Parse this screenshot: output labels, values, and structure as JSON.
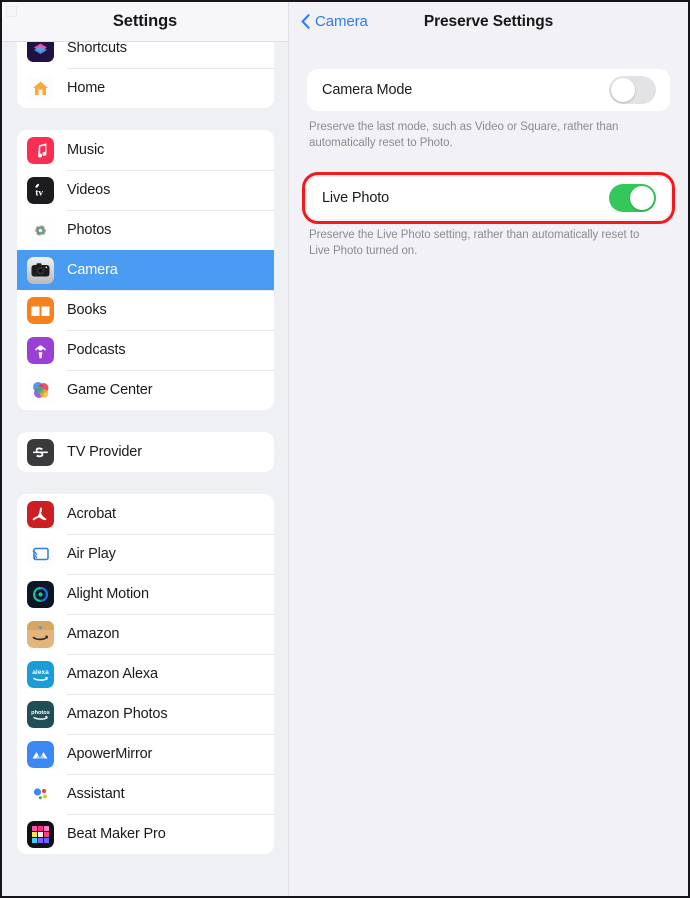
{
  "sidebar": {
    "title": "Settings",
    "groups": [
      {
        "name": "system-apps-top",
        "items": [
          {
            "label": "Shortcuts",
            "icon": "shortcuts-icon"
          },
          {
            "label": "Home",
            "icon": "home-icon"
          }
        ]
      },
      {
        "name": "media-apps",
        "items": [
          {
            "label": "Music",
            "icon": "music-icon"
          },
          {
            "label": "Videos",
            "icon": "apple-tv-icon"
          },
          {
            "label": "Photos",
            "icon": "photos-icon"
          },
          {
            "label": "Camera",
            "icon": "camera-icon",
            "selected": true
          },
          {
            "label": "Books",
            "icon": "books-icon"
          },
          {
            "label": "Podcasts",
            "icon": "podcasts-icon"
          },
          {
            "label": "Game Center",
            "icon": "game-center-icon"
          }
        ]
      },
      {
        "name": "tv-provider",
        "items": [
          {
            "label": "TV Provider",
            "icon": "tv-provider-icon"
          }
        ]
      },
      {
        "name": "third-party-apps",
        "items": [
          {
            "label": "Acrobat",
            "icon": "acrobat-icon"
          },
          {
            "label": "Air Play",
            "icon": "airplay-icon"
          },
          {
            "label": "Alight Motion",
            "icon": "alight-motion-icon"
          },
          {
            "label": "Amazon",
            "icon": "amazon-icon"
          },
          {
            "label": "Amazon Alexa",
            "icon": "amazon-alexa-icon"
          },
          {
            "label": "Amazon Photos",
            "icon": "amazon-photos-icon"
          },
          {
            "label": "ApowerMirror",
            "icon": "apowermirror-icon"
          },
          {
            "label": "Assistant",
            "icon": "assistant-icon"
          },
          {
            "label": "Beat Maker Pro",
            "icon": "beat-maker-pro-icon"
          }
        ]
      }
    ]
  },
  "detail": {
    "back_label": "Camera",
    "title": "Preserve Settings",
    "settings": [
      {
        "label": "Camera Mode",
        "toggle_state": "off",
        "footnote": "Preserve the last mode, such as Video or Square, rather than automatically reset to Photo.",
        "highlighted": false
      },
      {
        "label": "Live Photo",
        "toggle_state": "on",
        "footnote": "Preserve the Live Photo setting, rather than automatically reset to Live Photo turned on.",
        "highlighted": true
      }
    ]
  },
  "colors": {
    "accent_blue": "#2d7cf6",
    "selected_row": "#4a9cf2",
    "toggle_on_green": "#34c759",
    "toggle_off_gray": "#e3e3e6",
    "annotation_red": "#f51a19",
    "page_background": "#f1f1f6"
  }
}
